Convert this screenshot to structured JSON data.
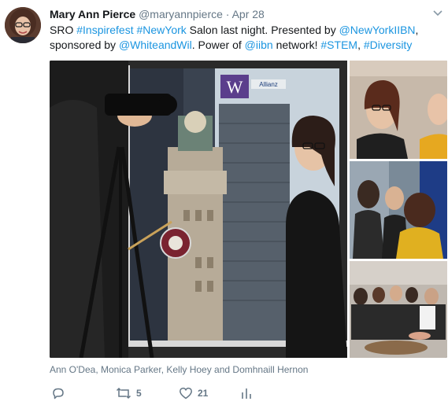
{
  "tweet": {
    "author_name": "Mary Ann Pierce",
    "author_handle": "@maryannpierce",
    "separator": "·",
    "date": "Apr 28",
    "text": [
      {
        "t": "SRO ",
        "link": false
      },
      {
        "t": "#Inspirefest",
        "link": true
      },
      {
        "t": " ",
        "link": false
      },
      {
        "t": "#NewYork",
        "link": true
      },
      {
        "t": " Salon last night. Presented by ",
        "link": false
      },
      {
        "t": "@NewYorkIIBN",
        "link": true
      },
      {
        "t": ", sponsored by ",
        "link": false
      },
      {
        "t": "@WhiteandWil",
        "link": true
      },
      {
        "t": ". Power of ",
        "link": false
      },
      {
        "t": "@iibn",
        "link": true
      },
      {
        "t": " network! ",
        "link": false
      },
      {
        "t": "#STEM",
        "link": true
      },
      {
        "t": ", ",
        "link": false
      },
      {
        "t": "#Diversity",
        "link": true
      }
    ],
    "caption": "Ann O'Dea, Monica Parker, Kelly Hoey and Domhnaill Hernon"
  },
  "actions": {
    "reply_count": "",
    "retweet_count": "5",
    "like_count": "21"
  },
  "media": {
    "building_sign": "W",
    "sign_right": "Allianz"
  },
  "colors": {
    "link": "#1b95e0",
    "muted": "#657786",
    "text": "#14171a"
  },
  "icons": [
    "chevron-down-icon",
    "reply-icon",
    "retweet-icon",
    "like-icon",
    "analytics-icon"
  ]
}
